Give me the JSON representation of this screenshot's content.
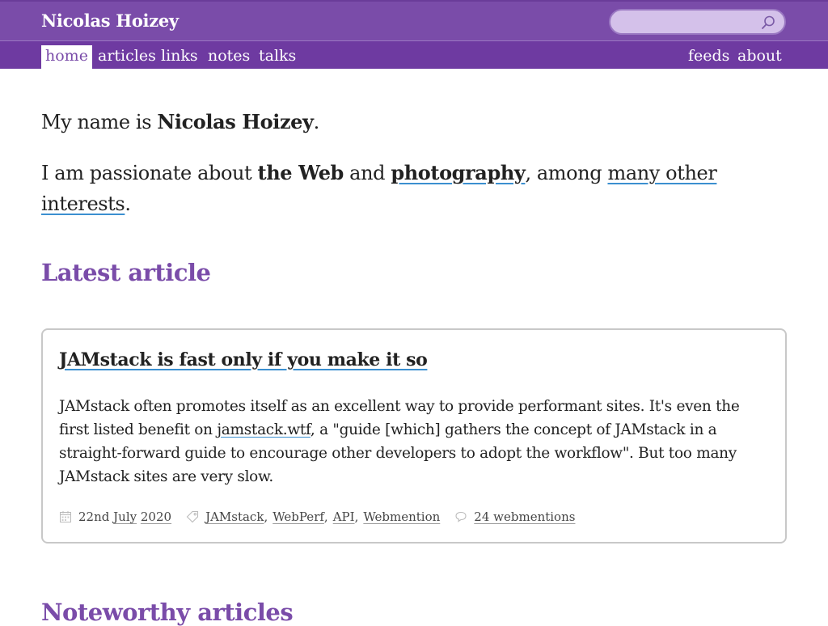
{
  "header": {
    "site_title": "Nicolas Hoizey",
    "search": {
      "value": "",
      "placeholder": ""
    }
  },
  "nav": {
    "left": [
      {
        "label": "home",
        "active": true
      },
      {
        "label": "articles"
      },
      {
        "label": "links"
      },
      {
        "label": "notes"
      },
      {
        "label": "talks"
      }
    ],
    "right": [
      {
        "label": "feeds"
      },
      {
        "label": "about"
      }
    ]
  },
  "intro": {
    "line1_prefix": "My name is ",
    "name": "Nicolas Hoizey",
    "line1_suffix": ".",
    "line2_prefix": "I am passionate about ",
    "topic_web": "the Web",
    "and": " and ",
    "topic_photo": "photography",
    "among": ", among ",
    "many_other": "many other",
    "interests": "interests",
    "line2_suffix": "."
  },
  "latest": {
    "heading": "Latest article",
    "article": {
      "title": "JAMstack is fast only if you make it so",
      "excerpt_a": "JAMstack often promotes itself as an excellent way to provide performant sites. It's even the first listed benefit on ",
      "excerpt_link": "jamstack.wtf",
      "excerpt_b": ", a \"guide [which] gathers the concept of JAMstack in a straight-forward guide to encourage other developers to adopt the workflow\". But too many JAMstack sites are very slow.",
      "date": {
        "day": "22nd",
        "month": "July",
        "year": "2020"
      },
      "tags": [
        "JAMstack",
        "WebPerf",
        "API",
        "Webmention"
      ],
      "webmentions": "24 webmentions"
    }
  },
  "noteworthy": {
    "heading": "Noteworthy articles"
  },
  "colors": {
    "brand": "#7a4ca9",
    "nav_bg": "#6e3aa1",
    "link_underline": "#3b8fd0"
  },
  "icons": {
    "search": "magnifier-icon",
    "date": "calendar-icon",
    "tags": "tag-icon",
    "webmentions": "comment-icon"
  }
}
